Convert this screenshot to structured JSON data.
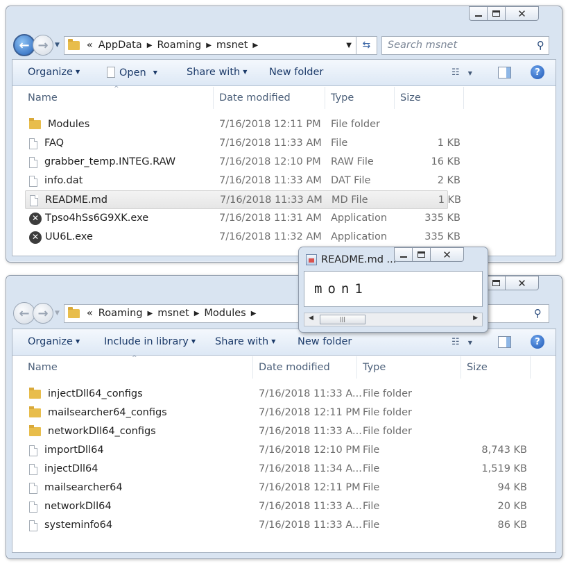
{
  "window1": {
    "breadcrumb": {
      "overflow": "«",
      "parts": [
        "AppData",
        "Roaming",
        "msnet"
      ]
    },
    "search_placeholder": "Search msnet",
    "toolbar": {
      "organize": "Organize",
      "open": "Open",
      "share_with": "Share with",
      "new_folder": "New folder"
    },
    "columns": {
      "name": "Name",
      "date": "Date modified",
      "type": "Type",
      "size": "Size"
    },
    "files": [
      {
        "name": "Modules",
        "date": "7/16/2018 12:11 PM",
        "type": "File folder",
        "size": "",
        "icon": "folder-icon"
      },
      {
        "name": "FAQ",
        "date": "7/16/2018 11:33 AM",
        "type": "File",
        "size": "1 KB",
        "icon": "file-icon"
      },
      {
        "name": "grabber_temp.INTEG.RAW",
        "date": "7/16/2018 12:10 PM",
        "type": "RAW File",
        "size": "16 KB",
        "icon": "file-icon"
      },
      {
        "name": "info.dat",
        "date": "7/16/2018 11:33 AM",
        "type": "DAT File",
        "size": "2 KB",
        "icon": "file-icon"
      },
      {
        "name": "README.md",
        "date": "7/16/2018 11:33 AM",
        "type": "MD File",
        "size": "1 KB",
        "icon": "file-icon",
        "selected": true
      },
      {
        "name": "Tpso4hSs6G9XK.exe",
        "date": "7/16/2018 11:31 AM",
        "type": "Application",
        "size": "335 KB",
        "icon": "blocked-exe-icon"
      },
      {
        "name": "UU6L.exe",
        "date": "7/16/2018 11:32 AM",
        "type": "Application",
        "size": "335 KB",
        "icon": "blocked-exe-icon"
      }
    ]
  },
  "window2": {
    "breadcrumb": {
      "overflow": "«",
      "parts": [
        "Roaming",
        "msnet",
        "Modules"
      ]
    },
    "toolbar": {
      "organize": "Organize",
      "include_in_library": "Include in library",
      "share_with": "Share with",
      "new_folder": "New folder"
    },
    "columns": {
      "name": "Name",
      "date": "Date modified",
      "type": "Type",
      "size": "Size"
    },
    "files": [
      {
        "name": "injectDll64_configs",
        "date": "7/16/2018 11:33 A...",
        "type": "File folder",
        "size": "",
        "icon": "folder-icon"
      },
      {
        "name": "mailsearcher64_configs",
        "date": "7/16/2018 12:11 PM",
        "type": "File folder",
        "size": "",
        "icon": "folder-icon"
      },
      {
        "name": "networkDll64_configs",
        "date": "7/16/2018 11:33 A...",
        "type": "File folder",
        "size": "",
        "icon": "folder-icon"
      },
      {
        "name": "importDll64",
        "date": "7/16/2018 12:10 PM",
        "type": "File",
        "size": "8,743 KB",
        "icon": "file-icon"
      },
      {
        "name": "injectDll64",
        "date": "7/16/2018 11:34 A...",
        "type": "File",
        "size": "1,519 KB",
        "icon": "file-icon"
      },
      {
        "name": "mailsearcher64",
        "date": "7/16/2018 12:11 PM",
        "type": "File",
        "size": "94 KB",
        "icon": "file-icon"
      },
      {
        "name": "networkDll64",
        "date": "7/16/2018 11:33 A...",
        "type": "File",
        "size": "20 KB",
        "icon": "file-icon"
      },
      {
        "name": "systeminfo64",
        "date": "7/16/2018 11:33 A...",
        "type": "File",
        "size": "86 KB",
        "icon": "file-icon"
      }
    ]
  },
  "notepad": {
    "title": "README.md ...",
    "content": "mon1"
  }
}
